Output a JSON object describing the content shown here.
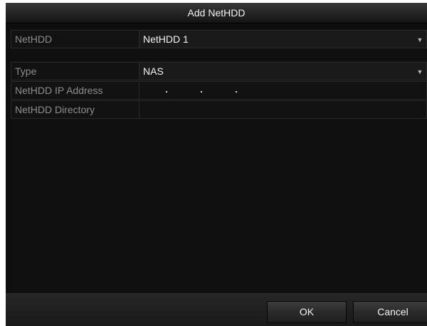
{
  "dialog": {
    "title": "Add NetHDD"
  },
  "fields": {
    "nethdd": {
      "label": "NetHDD",
      "value": "NetHDD 1",
      "icon": "chevron-down-icon"
    },
    "type": {
      "label": "Type",
      "value": "NAS",
      "icon": "chevron-down-icon"
    },
    "ip_address": {
      "label": "NetHDD IP Address",
      "value": ""
    },
    "directory": {
      "label": "NetHDD Directory",
      "value": ""
    }
  },
  "buttons": {
    "ok": "OK",
    "cancel": "Cancel"
  },
  "colors": {
    "background": "#0e0e0e",
    "label_text": "#8e8e8e",
    "value_text": "#f4f4f4",
    "border": "#2a2a2a"
  }
}
